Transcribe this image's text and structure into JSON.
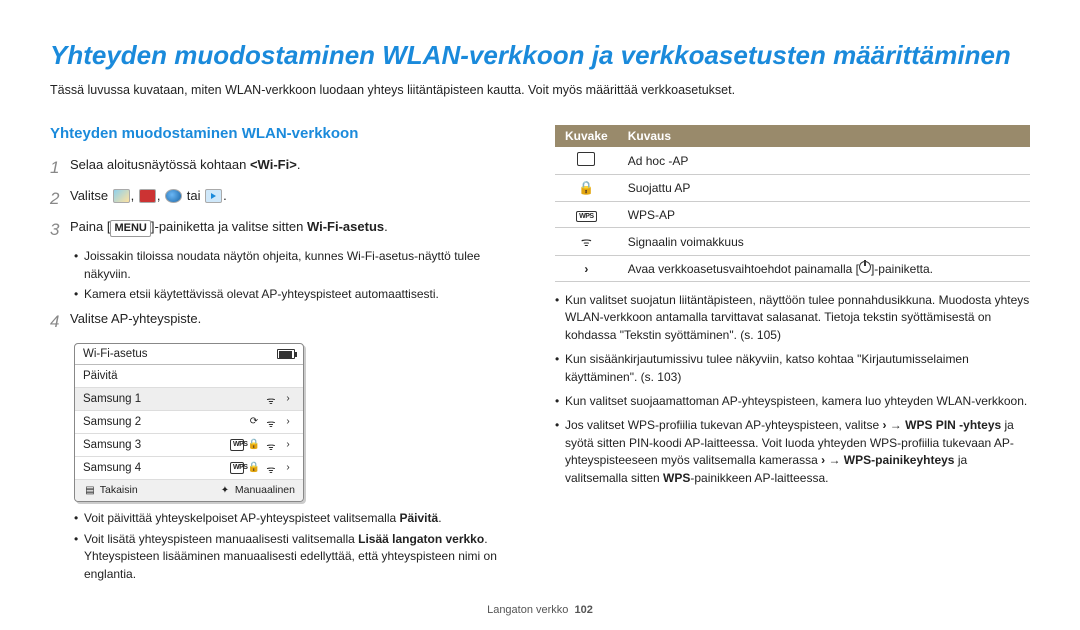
{
  "title": "Yhteyden muodostaminen WLAN-verkkoon ja verkkoasetusten määrittäminen",
  "intro": "Tässä luvussa kuvataan, miten WLAN-verkkoon luodaan yhteys liitäntäpisteen kautta. Voit myös määrittää verkkoasetukset.",
  "section_heading": "Yhteyden muodostaminen WLAN-verkkoon",
  "steps": {
    "n1": "1",
    "s1_a": "Selaa aloitusnäytössä kohtaan ",
    "s1_b": "<Wi-Fi>",
    "s1_c": ".",
    "n2": "2",
    "s2_a": "Valitse ",
    "s2_comma": ", ",
    "s2_or": " tai ",
    "s2_end": ".",
    "n3": "3",
    "s3_a": "Paina [",
    "s3_menu": "MENU",
    "s3_b": "]-painiketta ja valitse sitten ",
    "s3_c": "Wi-Fi-asetus",
    "s3_d": ".",
    "s3_sub1": "Joissakin tiloissa noudata näytön ohjeita, kunnes Wi-Fi-asetus-näyttö tulee näkyviin.",
    "s3_sub2": "Kamera etsii käytettävissä olevat AP-yhteyspisteet automaattisesti.",
    "n4": "4",
    "s4": "Valitse AP-yhteyspiste."
  },
  "wifi_panel": {
    "title": "Wi-Fi-asetus",
    "refresh": "Päivitä",
    "items": [
      "Samsung 1",
      "Samsung 2",
      "Samsung 3",
      "Samsung 4"
    ],
    "back": "Takaisin",
    "manual": "Manuaalinen"
  },
  "post_panel": {
    "b1_a": "Voit päivittää yhteyskelpoiset AP-yhteyspisteet valitsemalla ",
    "b1_b": "Päivitä",
    "b1_c": ".",
    "b2_a": "Voit lisätä yhteyspisteen manuaalisesti valitsemalla ",
    "b2_b": "Lisää langaton verkko",
    "b2_c": ". Yhteyspisteen lisääminen manuaalisesti edellyttää, että yhteyspisteen nimi on englantia."
  },
  "table": {
    "h1": "Kuvake",
    "h2": "Kuvaus",
    "r1": "Ad hoc -AP",
    "r2": "Suojattu AP",
    "r3": "WPS-AP",
    "r4": "Signaalin voimakkuus",
    "r5_a": "Avaa verkkoasetusvaihtoehdot painamalla [",
    "r5_b": "]-painiketta."
  },
  "right_bullets": {
    "b1": "Kun valitset suojatun liitäntäpisteen, näyttöön tulee ponnahdusikkuna. Muodosta yhteys WLAN-verkkoon antamalla tarvittavat salasanat. Tietoja tekstin syöttämisestä on kohdassa \"Tekstin syöttäminen\". (s. 105)",
    "b2": "Kun sisäänkirjautumissivu tulee näkyviin, katso kohtaa \"Kirjautumisselaimen käyttäminen\". (s. 103)",
    "b3": "Kun valitset suojaamattoman AP-yhteyspisteen, kamera luo yhteyden WLAN-verkkoon.",
    "b4_a": "Jos valitset WPS-profiilia tukevan AP-yhteyspisteen, valitse ",
    "b4_arrow": " → ",
    "b4_b": "WPS PIN -yhteys",
    "b4_c": " ja syötä sitten PIN-koodi AP-laitteessa. Voit luoda yhteyden WPS-profiilia tukevaan AP-yhteyspisteeseen myös valitsemalla kamerassa ",
    "b4_d": "WPS-painikeyhteys",
    "b4_e": " ja valitsemalla sitten ",
    "b4_f": "WPS",
    "b4_g": "-painikkeen AP-laitteessa."
  },
  "footer": {
    "section": "Langaton verkko",
    "page": "102"
  }
}
